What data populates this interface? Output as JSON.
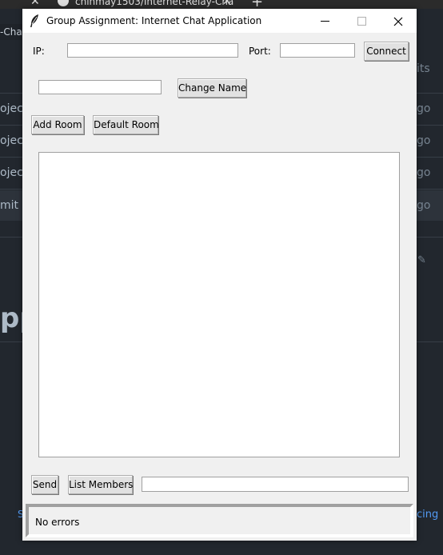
{
  "background": {
    "tab_title": "chinmay1503/Internet-Relay-Cha",
    "url_fragment": "-Chat",
    "left_rows": [
      "oject",
      "oject",
      "oject",
      "mit"
    ],
    "right_rows": [
      "its",
      "go",
      "go",
      "go",
      "go"
    ],
    "big_heading_fragment": "pp",
    "left_link": "S",
    "right_link": "cing"
  },
  "window": {
    "title": "Group Assignment: Internet Chat Application"
  },
  "connection": {
    "ip_label": "IP:",
    "ip_value": "",
    "port_label": "Port:",
    "port_value": "",
    "connect_button": "Connect"
  },
  "name": {
    "value": "",
    "change_button": "Change Name"
  },
  "rooms": {
    "add_button": "Add Room",
    "default_button": "Default Room"
  },
  "message": {
    "send_button": "Send",
    "list_members_button": "List Members",
    "input_value": ""
  },
  "status": {
    "text": "No errors"
  }
}
